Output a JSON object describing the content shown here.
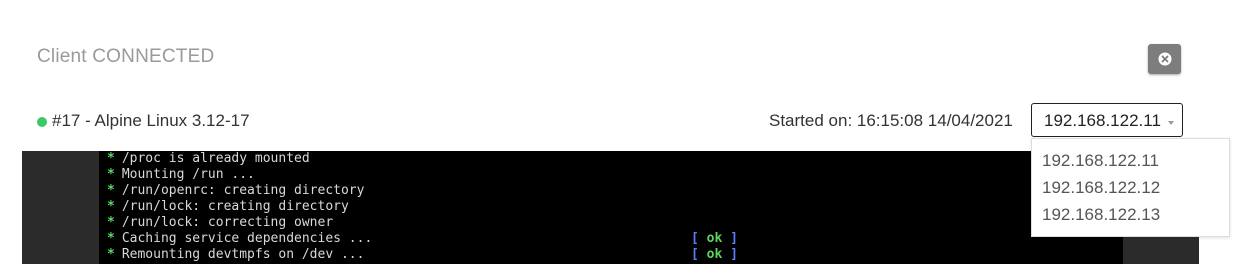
{
  "header": {
    "title": "Client CONNECTED"
  },
  "vm": {
    "name": "#17 - Alpine Linux 3.12-17",
    "started": "Started on: 16:15:08 14/04/2021",
    "status_color": "#3ec76a"
  },
  "ip_select": {
    "selected": "192.168.122.11",
    "options": [
      "192.168.122.11",
      "192.168.122.12",
      "192.168.122.13"
    ]
  },
  "console": {
    "lines": [
      "/proc is already mounted",
      "Mounting /run ...",
      "/run/openrc: creating directory",
      "/run/lock: creating directory",
      "/run/lock: correcting owner",
      "Caching service dependencies ...",
      "Remounting devtmpfs on /dev ..."
    ],
    "bullet": "*",
    "ok_open": "[ ",
    "ok_word": "ok",
    "ok_close": " ]"
  },
  "icons": {
    "close": "close-circle-icon"
  }
}
